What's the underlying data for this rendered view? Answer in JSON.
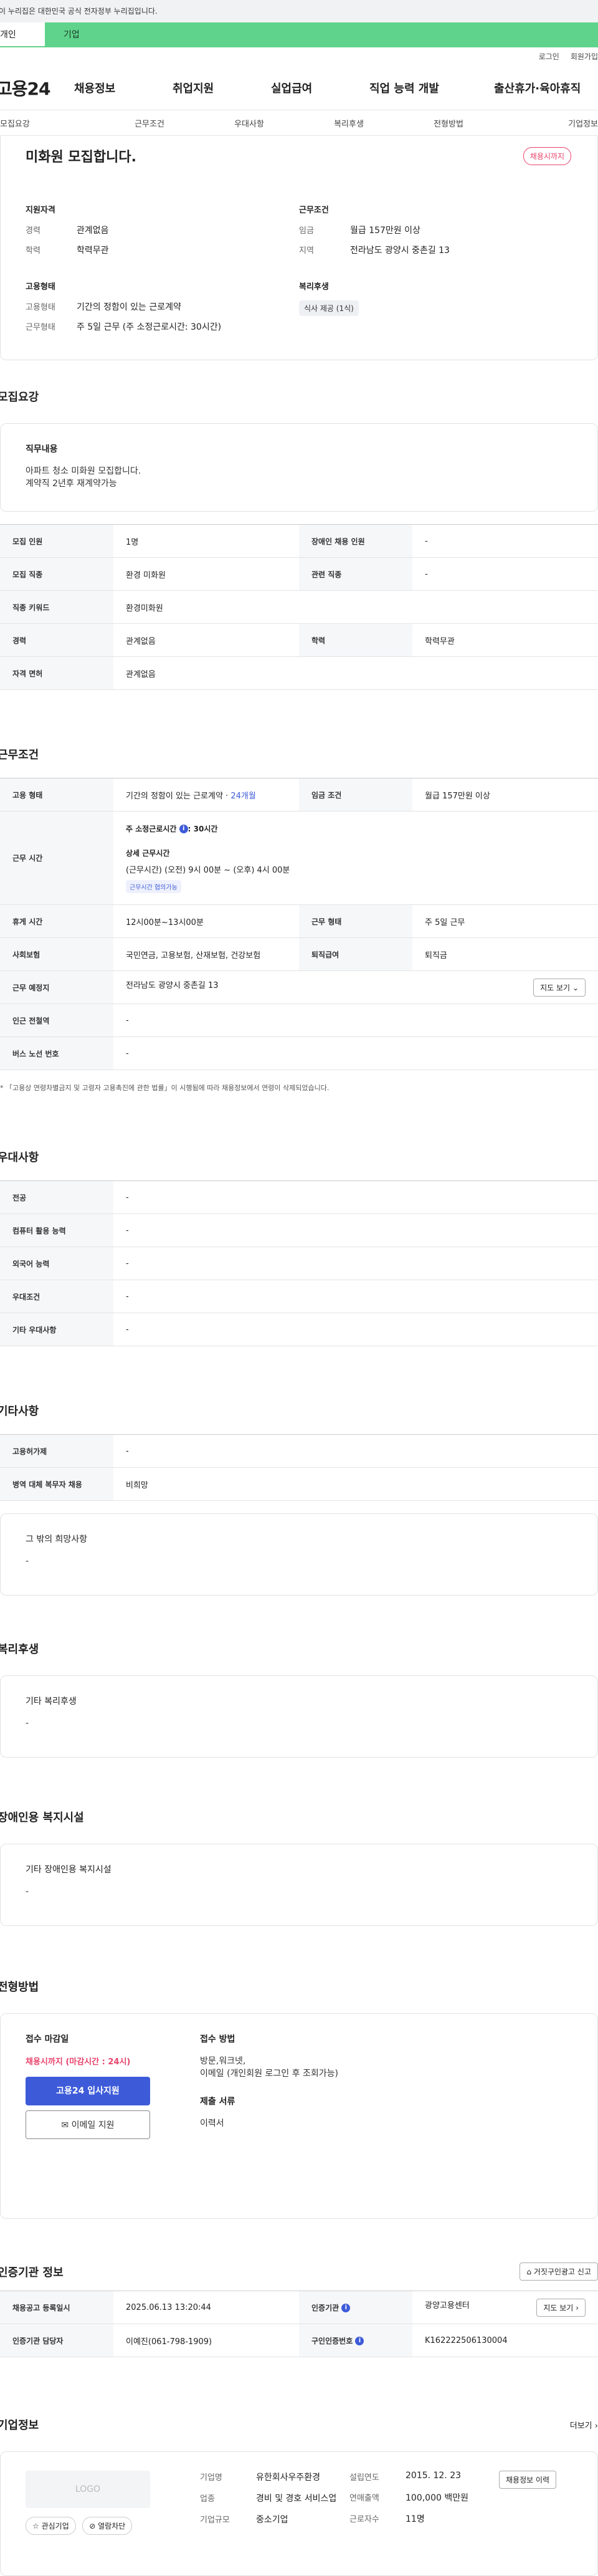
{
  "gov_notice": "이 누리집은 대한민국 공식 전자정부 누리집입니다.",
  "tabs": {
    "individual": "개인",
    "business": "기업"
  },
  "util": {
    "login": "로그인",
    "join": "회원가입"
  },
  "logo": "고용24",
  "gnb": [
    "채용정보",
    "취업지원",
    "실업급여",
    "직업 능력 개발",
    "출산휴가·육아휴직"
  ],
  "subnav": [
    "모집요강",
    "근무조건",
    "우대사항",
    "복리후생",
    "전형방법",
    "기업정보"
  ],
  "summary": {
    "title": "미화원 모집합니다.",
    "deadline_badge": "채용시까지",
    "qual_h": "지원자격",
    "career_k": "경력",
    "career_v": "관계없음",
    "edu_k": "학력",
    "edu_v": "학력무관",
    "cond_h": "근무조건",
    "wage_k": "임금",
    "wage_v": "월급 157만원 이상",
    "region_k": "지역",
    "region_v": "전라남도 광양시 중촌길 13",
    "type_h": "고용형태",
    "emp_k": "고용형태",
    "emp_v": "기간의 정함이 있는 근로계약",
    "work_k": "근무형태",
    "work_v": "주 5일 근무 (주 소정근로시간: 30시간)",
    "welfare_h": "복리후생",
    "welfare_chip": "식사 제공 (1식)"
  },
  "recruit": {
    "title": "모집요강",
    "job_h": "직무내용",
    "job_t1": "아파트 청소 미화원 모집합니다.",
    "job_t2": "계약직 2년후 재계약가능",
    "rows": [
      [
        "모집 인원",
        "1명",
        "장애인 채용 인원",
        "-"
      ],
      [
        "모집 직종",
        "환경 미화원",
        "관련 직종",
        "-"
      ],
      [
        "직종 키워드",
        "환경미화원"
      ],
      [
        "경력",
        "관계없음",
        "학력",
        "학력무관"
      ],
      [
        "자격 면허",
        "관계없음"
      ]
    ]
  },
  "cond": {
    "title": "근무조건",
    "emp_th": "고용 형태",
    "emp_v": "기간의 정함이 있는 근로계약 · ",
    "emp_months": "24개월",
    "wage_th": "임금 조건",
    "wage_v": "월급 157만원 이상",
    "hours_th": "근무 시간",
    "hours_week": "주 소정근로시간",
    "hours_week_v": ": 30시간",
    "hours_detail_h": "상세 근무시간",
    "hours_detail": "(근무시간) (오전) 9시 00분 ~ (오후) 4시 00분",
    "hours_chip": "근무시간 협의가능",
    "break_th": "휴게 시간",
    "break_v": "12시00분~13시00분",
    "worktype_th": "근무 형태",
    "worktype_v": "주 5일 근무",
    "insurance_th": "사회보험",
    "insurance_v": "국민연금, 고용보험, 산재보험, 건강보험",
    "retire_th": "퇴직급여",
    "retire_v": "퇴직금",
    "place_th": "근무 예정지",
    "place_v": "전라남도 광양시 중촌길 13",
    "map_btn": "지도 보기",
    "subway_th": "인근 전철역",
    "subway_v": "-",
    "bus_th": "버스 노선 번호",
    "bus_v": "-",
    "note": "* 「고용상 연령차별금지 및 고령자 고용촉진에 관한 법률」이 시행됨에 따라 채용정보에서 연령이 삭제되었습니다."
  },
  "pref": {
    "title": "우대사항",
    "rows": [
      [
        "전공",
        "-"
      ],
      [
        "컴퓨터 활용 능력",
        "-"
      ],
      [
        "외국어 능력",
        "-"
      ],
      [
        "우대조건",
        "-"
      ],
      [
        "기타 우대사항",
        "-"
      ]
    ]
  },
  "other": {
    "title": "기타사항",
    "rows": [
      [
        "고용허가제",
        "-"
      ],
      [
        "병역 대체 복무자 채용",
        "비희망"
      ]
    ],
    "box_h": "그 밖의 희망사항",
    "box_t": "-"
  },
  "welfare": {
    "title": "복리후생",
    "box_h": "기타 복리후생",
    "box_t": "-"
  },
  "disabled": {
    "title": "장애인용 복지시설",
    "box_h": "기타 장애인용 복지시설",
    "box_t": "-"
  },
  "apply": {
    "title": "전형방법",
    "deadline_h": "접수 마감일",
    "deadline_v": "채용시까지 (마감시간 : 24시)",
    "apply_btn": "고용24 입사지원",
    "email_btn": "이메일 지원",
    "method_h": "접수 방법",
    "method_v1": "방문,워크넷,",
    "method_v2": "이메일 (개인회원 로그인 후 조회가능)",
    "docs_h": "제출 서류",
    "docs_v": "이력서"
  },
  "cert": {
    "title": "인증기관 정보",
    "report_btn": "거짓구인광고 신고",
    "reg_th": "채용공고 등록일시",
    "reg_v": "2025.06.13 13:20:44",
    "org_th": "인증기관",
    "org_v": "광양고용센터",
    "detail_btn": "지도 보기",
    "manager_th": "인증기관 담당자",
    "manager_v": "이예진(061-798-1909)",
    "no_th": "구인인증번호",
    "no_v": "K162222506130004"
  },
  "company": {
    "title": "기업정보",
    "more": "더보기",
    "logo": "LOGO",
    "fav_btn": "관심기업",
    "block_btn": "열람차단",
    "name_k": "기업명",
    "name_v": "유한회사우주환경",
    "industry_k": "업종",
    "industry_v": "경비 및 경호 서비스업",
    "size_k": "기업규모",
    "size_v": "중소기업",
    "founded_k": "설립연도",
    "founded_v": "2015. 12. 23",
    "sales_k": "연매출액",
    "sales_v": "100,000 백만원",
    "staff_k": "근로자수",
    "staff_v": "11명",
    "history_btn": "채용정보 이력"
  }
}
